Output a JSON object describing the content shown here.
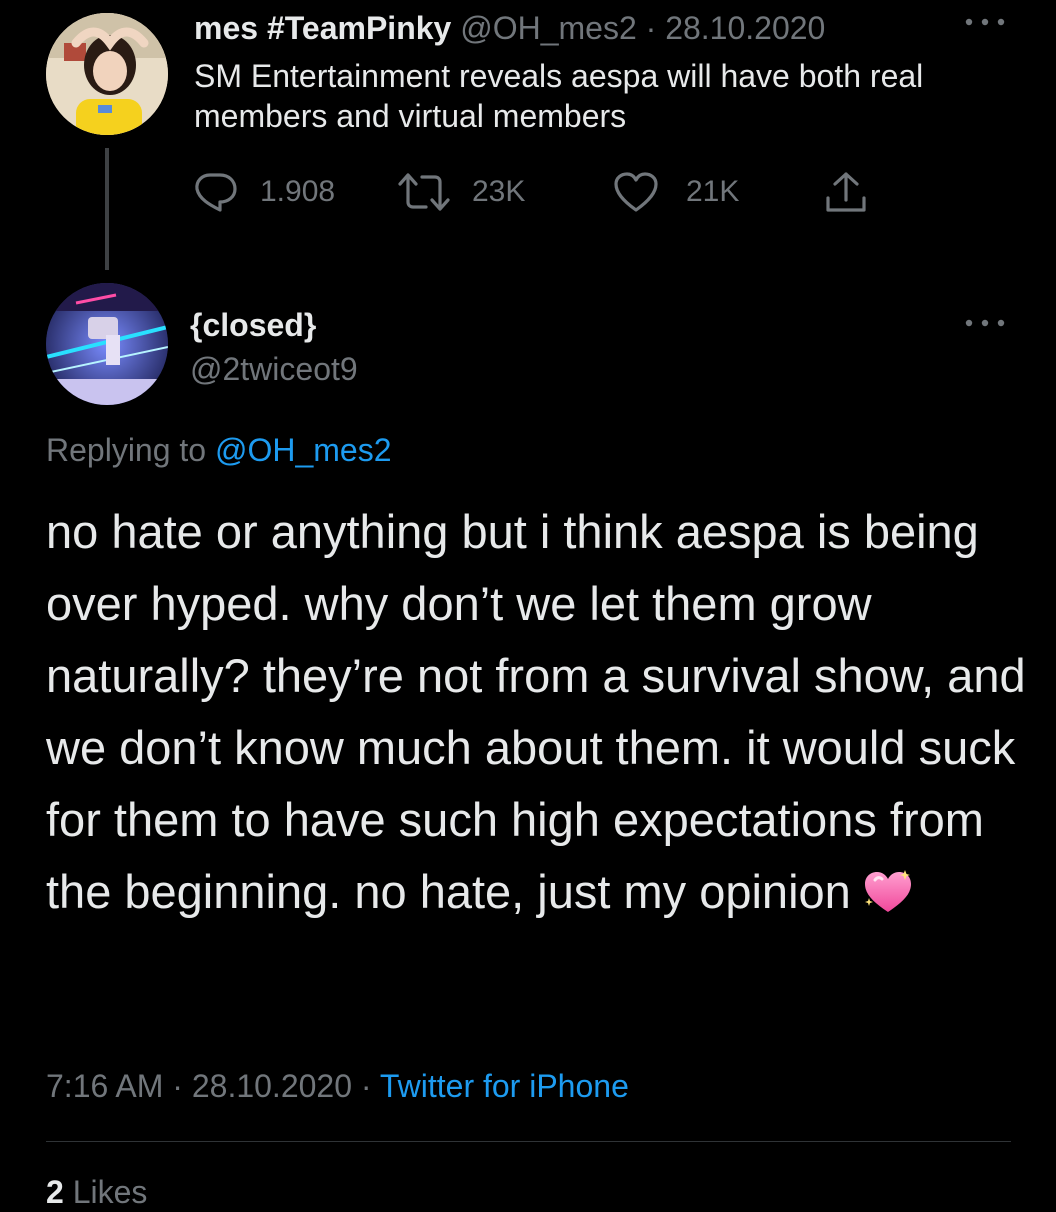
{
  "colors": {
    "background": "#000000",
    "text_primary": "#e7e9ea",
    "text_secondary": "#71767b",
    "link": "#1d9bf0",
    "thread_line": "#3e4144",
    "divider": "#2f3336"
  },
  "parent_tweet": {
    "display_name": "mes #TeamPinky",
    "handle": "@OH_mes2",
    "separator": " · ",
    "date": "28.10.2020",
    "text": "SM Entertainment reveals aespa will have both real members and virtual members",
    "more_icon": "more-dots-icon",
    "actions": {
      "replies": {
        "icon": "reply-icon",
        "count": "1.908"
      },
      "retweets": {
        "icon": "retweet-icon",
        "count": "23K"
      },
      "likes": {
        "icon": "like-icon",
        "count": "21K"
      },
      "share": {
        "icon": "share-icon"
      }
    }
  },
  "main_tweet": {
    "display_name": "{closed}",
    "handle": "@2twiceot9",
    "more_icon": "more-dots-icon",
    "replying_prefix": "Replying to ",
    "replying_to": "@OH_mes2",
    "text": "no hate or anything but i think aespa is being over hyped. why don’t we let them grow naturally? they’re not from a survival show, and we don’t know much about them. it would suck for them to have such high expectations from the beginning. no hate, just my opinion",
    "emoji_icon": "sparkling-heart-icon",
    "time": "7:16 AM",
    "separator": " · ",
    "date": "28.10.2020",
    "source": "Twitter for iPhone",
    "likes_count": "2",
    "likes_label": " Likes"
  }
}
